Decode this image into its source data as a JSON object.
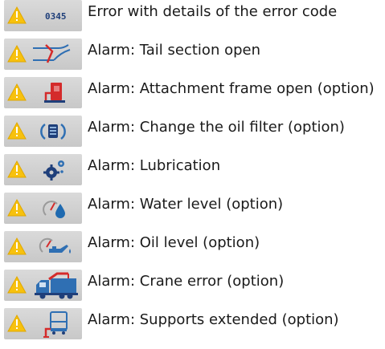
{
  "colors": {
    "warning": "#f7c10e",
    "icon_blue": "#2f6fb3",
    "icon_red": "#d42b2b",
    "icon_dark": "#1f3f7a"
  },
  "rows": [
    {
      "icon": "error-code-icon",
      "code": "0345",
      "label": "Error with details of the error code"
    },
    {
      "icon": "tail-section-icon",
      "label": "Alarm: Tail section open"
    },
    {
      "icon": "attachment-frame-icon",
      "label": "Alarm: Attachment frame open (option)"
    },
    {
      "icon": "oil-filter-icon",
      "label": "Alarm: Change the oil filter (option)"
    },
    {
      "icon": "lubrication-gears-icon",
      "label": "Alarm: Lubrication"
    },
    {
      "icon": "water-level-icon",
      "label": "Alarm: Water level (option)"
    },
    {
      "icon": "oil-level-icon",
      "label": "Alarm: Oil level (option)"
    },
    {
      "icon": "crane-truck-icon",
      "label": "Alarm: Crane error (option)"
    },
    {
      "icon": "supports-extended-icon",
      "label": "Alarm: Supports extended (option)"
    }
  ]
}
